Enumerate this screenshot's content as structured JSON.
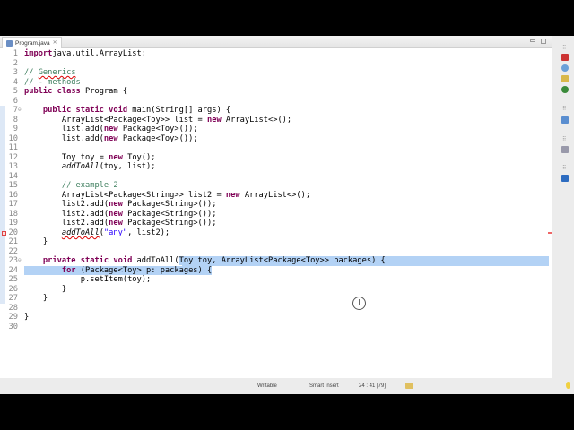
{
  "tab": {
    "label": "Program.java",
    "close": "✕"
  },
  "lines": [
    {
      "n": "1",
      "s": [
        [
          "kw",
          "import"
        ],
        [
          "",
          "java.util.ArrayList;"
        ]
      ]
    },
    {
      "n": "2",
      "s": []
    },
    {
      "n": "3",
      "s": [
        [
          "cm",
          "// "
        ],
        [
          "cm err",
          "Generics"
        ]
      ]
    },
    {
      "n": "4",
      "s": [
        [
          "cm",
          "// - methods"
        ]
      ]
    },
    {
      "n": "5",
      "s": [
        [
          "kw",
          "public"
        ],
        [
          "",
          " "
        ],
        [
          "kw",
          "class"
        ],
        [
          "",
          " Program {"
        ]
      ]
    },
    {
      "n": "6",
      "s": []
    },
    {
      "n": "7",
      "fold": "⊖",
      "s": [
        [
          "",
          "    "
        ],
        [
          "kw",
          "public static void"
        ],
        [
          "",
          " main(String[] args) {"
        ]
      ]
    },
    {
      "n": "8",
      "s": [
        [
          "",
          "        ArrayList<Package<Toy>> list = "
        ],
        [
          "kw",
          "new"
        ],
        [
          "",
          " ArrayList<>();"
        ]
      ]
    },
    {
      "n": "9",
      "s": [
        [
          "",
          "        list.add("
        ],
        [
          "kw",
          "new"
        ],
        [
          "",
          " Package<Toy>());"
        ]
      ]
    },
    {
      "n": "10",
      "s": [
        [
          "",
          "        list.add("
        ],
        [
          "kw",
          "new"
        ],
        [
          "",
          " Package<Toy>());"
        ]
      ]
    },
    {
      "n": "11",
      "s": []
    },
    {
      "n": "12",
      "s": [
        [
          "",
          "        Toy toy = "
        ],
        [
          "kw",
          "new"
        ],
        [
          "",
          " Toy();"
        ]
      ]
    },
    {
      "n": "13",
      "s": [
        [
          "",
          "        "
        ],
        [
          "it",
          "addToAll"
        ],
        [
          "",
          "(toy, list);"
        ]
      ]
    },
    {
      "n": "14",
      "s": []
    },
    {
      "n": "15",
      "s": [
        [
          "",
          "        "
        ],
        [
          "cm",
          "// example 2"
        ]
      ]
    },
    {
      "n": "16",
      "s": [
        [
          "",
          "        ArrayList<Package<String>> list2 = "
        ],
        [
          "kw",
          "new"
        ],
        [
          "",
          " ArrayList<>();"
        ]
      ]
    },
    {
      "n": "17",
      "s": [
        [
          "",
          "        list2.add("
        ],
        [
          "kw",
          "new"
        ],
        [
          "",
          " Package<String>());"
        ]
      ]
    },
    {
      "n": "18",
      "s": [
        [
          "",
          "        list2.add("
        ],
        [
          "kw",
          "new"
        ],
        [
          "",
          " Package<String>());"
        ]
      ]
    },
    {
      "n": "19",
      "s": [
        [
          "",
          "        list2.add("
        ],
        [
          "kw",
          "new"
        ],
        [
          "",
          " Package<String>());"
        ]
      ]
    },
    {
      "n": "20",
      "error": true,
      "s": [
        [
          "",
          "        "
        ],
        [
          "it err",
          "addToAll"
        ],
        [
          "",
          "("
        ],
        [
          "st",
          "\"any\""
        ],
        [
          "",
          ", list2);"
        ]
      ]
    },
    {
      "n": "21",
      "s": [
        [
          "",
          "    }"
        ]
      ]
    },
    {
      "n": "22",
      "s": []
    },
    {
      "n": "23",
      "fold": "⊖",
      "eol": true,
      "s": [
        [
          "",
          "    "
        ],
        [
          "kw",
          "private static void"
        ],
        [
          "",
          " addToAll("
        ],
        [
          "sel",
          "Toy toy, ArrayList<Package<Toy>> packages) {"
        ]
      ]
    },
    {
      "n": "24",
      "s": [
        [
          "sel",
          "        "
        ],
        [
          "kw sel",
          "for"
        ],
        [
          "sel",
          " (Package<Toy> p: packages) {"
        ]
      ]
    },
    {
      "n": "25",
      "s": [
        [
          "",
          "            p.setItem(toy);"
        ]
      ]
    },
    {
      "n": "26",
      "s": [
        [
          "",
          "        }"
        ]
      ]
    },
    {
      "n": "27",
      "s": [
        [
          "",
          "    }"
        ]
      ]
    },
    {
      "n": "28",
      "s": []
    },
    {
      "n": "29",
      "s": [
        [
          "",
          "}"
        ]
      ]
    },
    {
      "n": "30",
      "s": []
    }
  ],
  "status": {
    "mode": "Writable",
    "insert": "Smart Insert",
    "position": "24 : 41 [79]"
  },
  "cursor_glyph": "I"
}
